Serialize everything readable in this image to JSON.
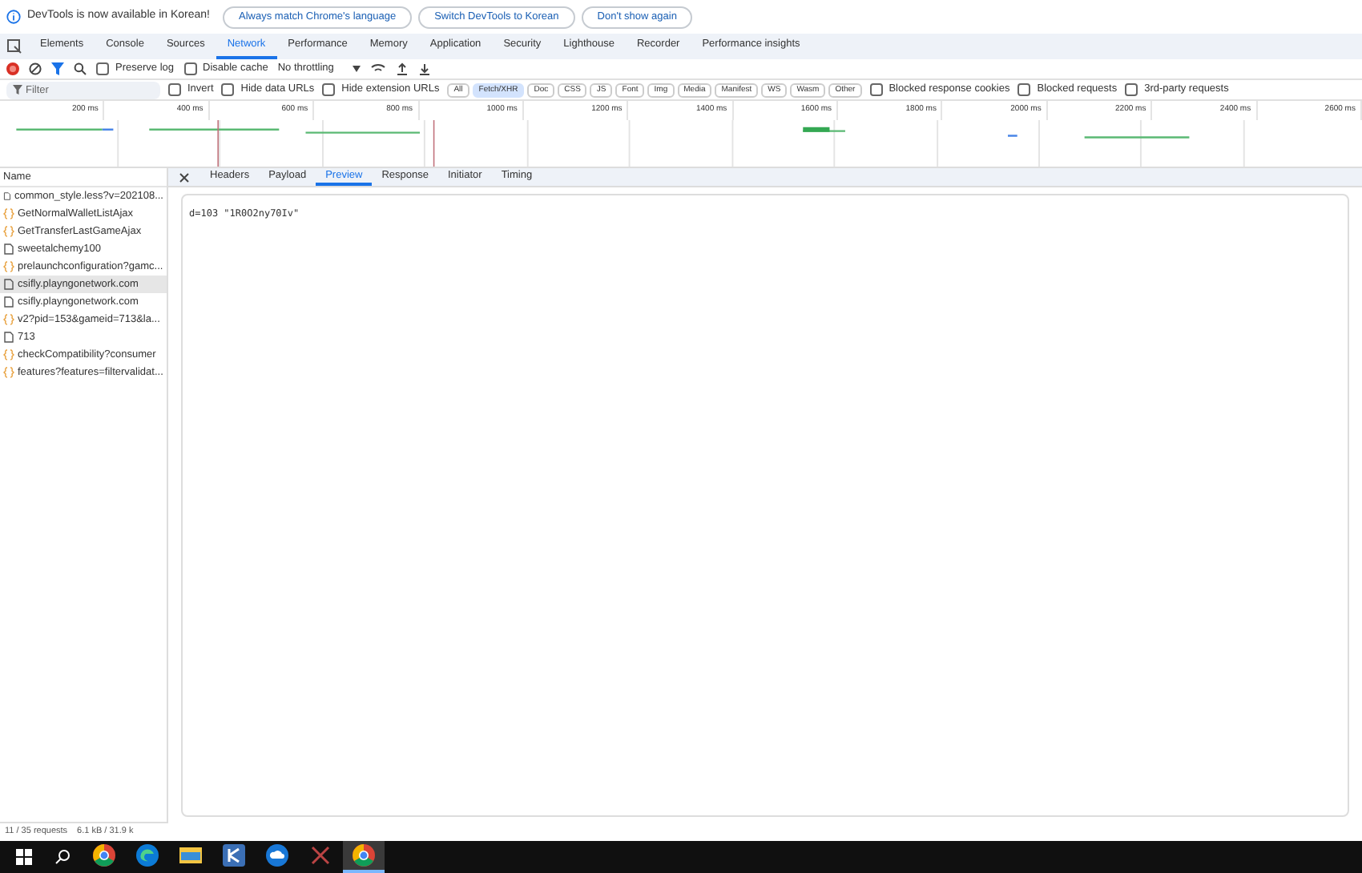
{
  "infobar": {
    "message": "DevTools is now available in Korean!",
    "buttons": [
      "Always match Chrome's language",
      "Switch DevTools to Korean",
      "Don't show again"
    ]
  },
  "tabs": [
    {
      "label": "Elements",
      "selected": false
    },
    {
      "label": "Console",
      "selected": false
    },
    {
      "label": "Sources",
      "selected": false
    },
    {
      "label": "Network",
      "selected": true
    },
    {
      "label": "Performance",
      "selected": false
    },
    {
      "label": "Memory",
      "selected": false
    },
    {
      "label": "Application",
      "selected": false
    },
    {
      "label": "Security",
      "selected": false
    },
    {
      "label": "Lighthouse",
      "selected": false
    },
    {
      "label": "Recorder",
      "selected": false
    },
    {
      "label": "Performance insights",
      "selected": false
    }
  ],
  "toolbar": {
    "recording": true,
    "filter_active": true,
    "checkboxes": [
      {
        "label": "Preserve log",
        "checked": false
      },
      {
        "label": "Disable cache",
        "checked": false
      }
    ],
    "throttling": "No throttling"
  },
  "filter": {
    "placeholder": "Filter",
    "checkboxes_left": [
      {
        "label": "Invert",
        "checked": false
      },
      {
        "label": "Hide data URLs",
        "checked": false
      },
      {
        "label": "Hide extension URLs",
        "checked": false
      }
    ],
    "types": [
      {
        "label": "All",
        "selected": false
      },
      {
        "label": "Fetch/XHR",
        "selected": true
      },
      {
        "label": "Doc",
        "selected": false
      },
      {
        "label": "CSS",
        "selected": false
      },
      {
        "label": "JS",
        "selected": false
      },
      {
        "label": "Font",
        "selected": false
      },
      {
        "label": "Img",
        "selected": false
      },
      {
        "label": "Media",
        "selected": false
      },
      {
        "label": "Manifest",
        "selected": false
      },
      {
        "label": "WS",
        "selected": false
      },
      {
        "label": "Wasm",
        "selected": false
      },
      {
        "label": "Other",
        "selected": false
      }
    ],
    "checkboxes_right": [
      {
        "label": "Blocked response cookies",
        "checked": false
      },
      {
        "label": "Blocked requests",
        "checked": false
      },
      {
        "label": "3rd-party requests",
        "checked": false
      }
    ]
  },
  "timeline": {
    "ticks": [
      "200 ms",
      "400 ms",
      "600 ms",
      "800 ms",
      "1000 ms",
      "1200 ms",
      "1400 ms",
      "1600 ms",
      "1800 ms",
      "2000 ms",
      "2200 ms",
      "2400 ms",
      "2600 ms"
    ]
  },
  "requests": {
    "header": "Name",
    "items": [
      {
        "name": "common_style.less?v=202108...",
        "kind": "doc",
        "selected": false
      },
      {
        "name": "GetNormalWalletListAjax",
        "kind": "xhr",
        "selected": false
      },
      {
        "name": "GetTransferLastGameAjax",
        "kind": "xhr",
        "selected": false
      },
      {
        "name": "sweetalchemy100",
        "kind": "doc",
        "selected": false
      },
      {
        "name": "prelaunchconfiguration?gamc...",
        "kind": "xhr",
        "selected": false
      },
      {
        "name": "csifly.playngonetwork.com",
        "kind": "doc",
        "selected": true
      },
      {
        "name": "csifly.playngonetwork.com",
        "kind": "doc",
        "selected": false
      },
      {
        "name": "v2?pid=153&gameid=713&la...",
        "kind": "xhr",
        "selected": false
      },
      {
        "name": "713",
        "kind": "doc",
        "selected": false
      },
      {
        "name": "checkCompatibility?consumer",
        "kind": "xhr",
        "selected": false
      },
      {
        "name": "features?features=filtervalidat...",
        "kind": "xhr",
        "selected": false
      }
    ]
  },
  "detail": {
    "tabs": [
      {
        "label": "Headers",
        "selected": false
      },
      {
        "label": "Payload",
        "selected": false
      },
      {
        "label": "Preview",
        "selected": true
      },
      {
        "label": "Response",
        "selected": false
      },
      {
        "label": "Initiator",
        "selected": false
      },
      {
        "label": "Timing",
        "selected": false
      }
    ],
    "preview": "d=103 \"1R0O2ny70Iv\""
  },
  "status_bar": {
    "requests": "11 / 35 requests",
    "transferred": "6.1 kB / 31.9 k"
  },
  "taskbar": {
    "apps": [
      {
        "kind": "chrome",
        "active": false
      },
      {
        "kind": "edge",
        "active": false
      },
      {
        "kind": "folder",
        "active": false
      },
      {
        "kind": "app",
        "active": false
      },
      {
        "kind": "cloud",
        "active": false
      },
      {
        "kind": "tool",
        "active": false
      },
      {
        "kind": "chrome",
        "active": true
      }
    ]
  }
}
